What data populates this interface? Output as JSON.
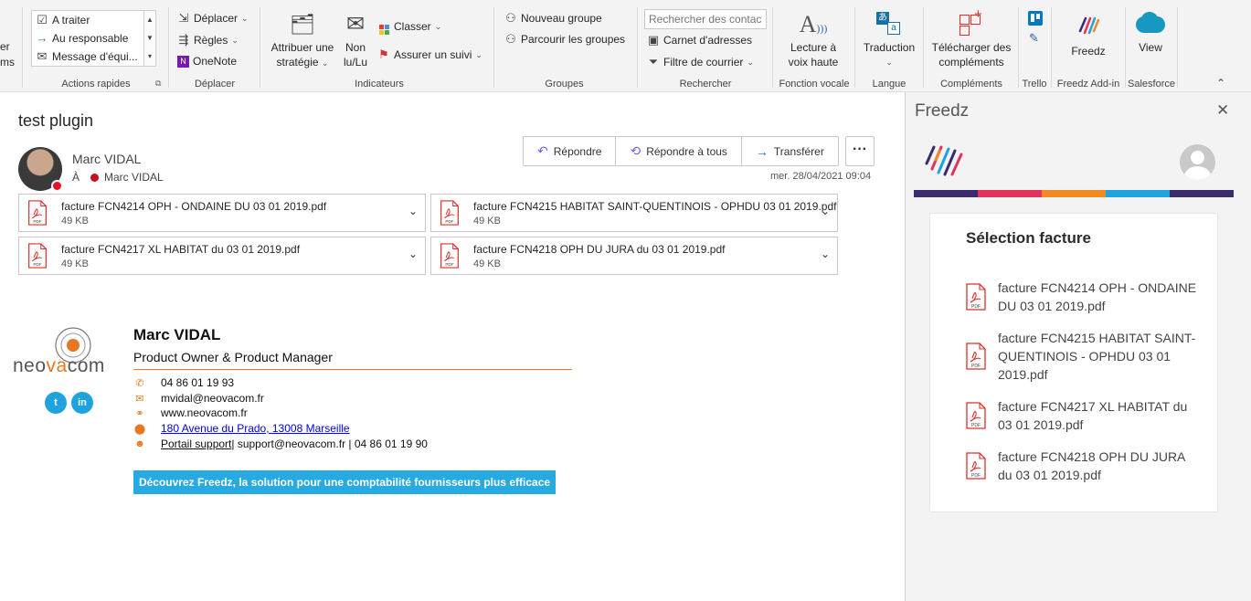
{
  "ribbon": {
    "partial_left": {
      "line1": "er",
      "line2": "ms"
    },
    "quick_steps": {
      "items": [
        "A traiter",
        "Au responsable",
        "Message d'équi..."
      ],
      "label": "Actions rapides"
    },
    "move": {
      "move_label": "Déplacer",
      "rules_label": "Règles",
      "onenote_label": "OneNote",
      "group_label": "Déplacer"
    },
    "tags": {
      "assign_line1": "Attribuer une",
      "assign_line2": "stratégie",
      "unread_line1": "Non",
      "unread_line2": "lu/Lu",
      "categorize_label": "Classer",
      "followup_label": "Assurer un suivi",
      "group_label": "Indicateurs"
    },
    "groups": {
      "new_group_label": "Nouveau groupe",
      "browse_groups_label": "Parcourir les groupes",
      "group_label": "Groupes"
    },
    "find": {
      "search_placeholder": "Rechercher des contacts",
      "address_book_label": "Carnet d'adresses",
      "filter_mail_label": "Filtre de courrier",
      "group_label": "Rechercher"
    },
    "voice": {
      "line1": "Lecture à",
      "line2": "voix haute",
      "group_label": "Fonction vocale"
    },
    "language": {
      "translate_label": "Traduction",
      "group_label": "Langue"
    },
    "addins": {
      "line1": "Télécharger des",
      "line2": "compléments",
      "group_label": "Compléments"
    },
    "trello": {
      "group_label": "Trello"
    },
    "freedz_addin": {
      "button_label": "Freedz",
      "group_label": "Freedz Add-in"
    },
    "salesforce": {
      "button_label": "View",
      "group_label": "Salesforce"
    }
  },
  "message": {
    "subject": "test plugin",
    "sender": "Marc VIDAL",
    "to_label": "À",
    "recipient": "Marc VIDAL",
    "date": "mer. 28/04/2021 09:04",
    "actions": {
      "reply": "Répondre",
      "reply_all": "Répondre à tous",
      "forward": "Transférer",
      "more": "···"
    },
    "attachments": [
      {
        "name": "facture FCN4214 OPH - ONDAINE DU 03 01 2019.pdf",
        "size": "49 KB"
      },
      {
        "name": "facture FCN4215 HABITAT SAINT-QUENTINOIS - OPHDU 03 01 2019.pdf",
        "size": "49 KB"
      },
      {
        "name": "facture FCN4217 XL HABITAT du 03 01 2019.pdf",
        "size": "49 KB"
      },
      {
        "name": "facture FCN4218 OPH DU JURA du 03 01 2019.pdf",
        "size": "49 KB"
      }
    ]
  },
  "signature": {
    "logo_text_1": "neo",
    "logo_text_2": "va",
    "logo_text_3": "com",
    "twitter_glyph": "t",
    "linkedin_glyph": "in",
    "name": "Marc VIDAL",
    "role": "Product Owner & Product Manager",
    "phone": "04 86 01 19 93",
    "email": "mvidal@neovacom.fr",
    "website": "www.neovacom.fr",
    "address": "180 Avenue du Prado, 13008 Marseille",
    "support_link": "Portail support",
    "support_rest": " | support@neovacom.fr | 04 86 01 19 90",
    "banner": "Découvrez Freedz, la solution pour une comptabilité fournisseurs plus efficace"
  },
  "freedz_pane": {
    "title": "Freedz",
    "close_glyph": "✕",
    "stripe_colors": [
      "#3b2a6e",
      "#e2335a",
      "#f08a24",
      "#1fa3dc",
      "#3b2a6e"
    ],
    "card_title": "Sélection facture",
    "invoices": [
      "facture FCN4214 OPH - ONDAINE DU 03 01 2019.pdf",
      "facture FCN4215 HABITAT SAINT-QUENTINOIS - OPHDU 03 01 2019.pdf",
      "facture FCN4217 XL HABITAT du 03 01 2019.pdf",
      "facture FCN4218 OPH DU JURA du 03 01 2019.pdf"
    ]
  },
  "icons": {
    "pdf": "pdf-icon",
    "accent_red": "#d9302b",
    "accent_orange": "#e87722"
  }
}
